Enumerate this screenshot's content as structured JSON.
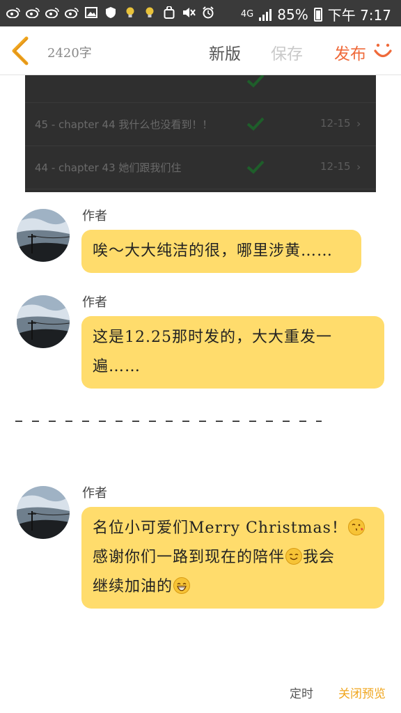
{
  "status_bar": {
    "battery": "85%",
    "time": "下午 7:17",
    "network": "4G",
    "icons": [
      "weibo-icon",
      "weibo-icon",
      "weibo-icon",
      "weibo-icon",
      "image-icon",
      "shield-icon",
      "bulb-icon",
      "bulb-icon",
      "bag-icon",
      "mute-icon",
      "alarm-icon"
    ]
  },
  "toolbar": {
    "word_count": "2420字",
    "new_label": "新版",
    "save_label": "保存",
    "publish_label": "发布",
    "colors": {
      "publish": "#ef6a3a",
      "back": "#f0a61e",
      "save_disabled": "#c9c9c9"
    }
  },
  "screenshot_card": {
    "rows": [
      {
        "title": "45 - chapter 44 我什么也没看到！！",
        "date": "12-15"
      },
      {
        "title": "44 - chapter 43 她们跟我们住",
        "date": "12-15"
      }
    ]
  },
  "messages": [
    {
      "author": "作者",
      "text": "唉～大大纯洁的很，哪里涉黄……"
    },
    {
      "author": "作者",
      "line1": "这是12.25那时发的，大大重发一",
      "line2": "遍……"
    },
    {
      "author": "作者",
      "line1": "名位小可爱们Merry Christmas！",
      "line2": "感谢你们一路到现在的陪伴",
      "line2_tail": "我会",
      "line3": "继续加油的",
      "emojis": [
        "kiss-emoji",
        "smile-emoji",
        "grin-emoji"
      ]
    }
  ],
  "bottom": {
    "timer_label": "定时",
    "close_preview_label": "关闭预览",
    "accent": "#f0a61e"
  }
}
